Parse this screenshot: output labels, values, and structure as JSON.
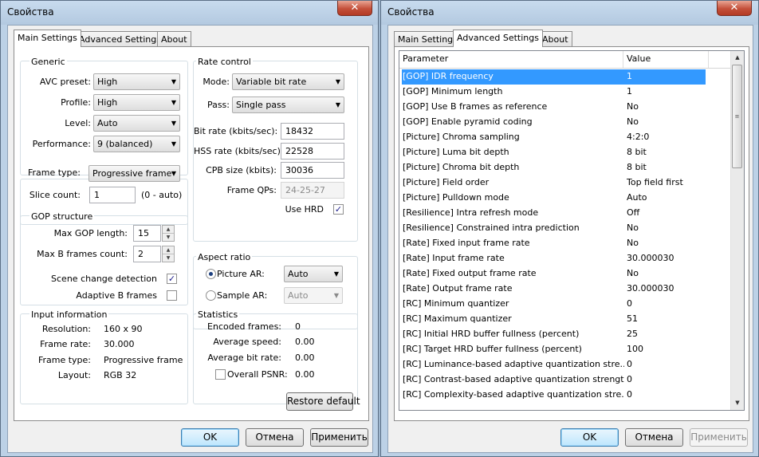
{
  "dialog_title": "Свойства",
  "tabs": [
    "Main Settings",
    "Advanced Settings",
    "About"
  ],
  "main": {
    "generic": {
      "title": "Generic",
      "avc_preset_label": "AVC preset:",
      "avc_preset": "High",
      "profile_label": "Profile:",
      "profile": "High",
      "level_label": "Level:",
      "level": "Auto",
      "performance_label": "Performance:",
      "performance": "9 (balanced)",
      "frame_type_label": "Frame type:",
      "frame_type": "Progressive frame",
      "slice_count_label": "Slice count:",
      "slice_count": "1",
      "slice_hint": "(0 - auto)"
    },
    "rate_control": {
      "title": "Rate control",
      "mode_label": "Mode:",
      "mode": "Variable bit rate",
      "pass_label": "Pass:",
      "pass": "Single pass",
      "bit_rate_label": "Bit rate (kbits/sec):",
      "bit_rate": "18432",
      "hss_rate_label": "HSS rate (kbits/sec):",
      "hss_rate": "22528",
      "cpb_size_label": "CPB size (kbits):",
      "cpb_size": "30036",
      "frame_qps_label": "Frame QPs:",
      "frame_qps": "24-25-27",
      "use_hrd_label": "Use HRD",
      "use_hrd": true
    },
    "gop": {
      "title": "GOP structure",
      "max_gop_label": "Max GOP length:",
      "max_gop": "15",
      "max_b_label": "Max B frames count:",
      "max_b": "2",
      "scene_change_label": "Scene change detection",
      "scene_change": true,
      "adaptive_b_label": "Adaptive B frames",
      "adaptive_b": false
    },
    "aspect": {
      "title": "Aspect ratio",
      "picture_ar_label": "Picture AR:",
      "picture_ar": "Auto",
      "picture_ar_selected": true,
      "sample_ar_label": "Sample AR:",
      "sample_ar": "Auto"
    },
    "input_info": {
      "title": "Input information",
      "resolution_label": "Resolution:",
      "resolution": "160 x 90",
      "frame_rate_label": "Frame rate:",
      "frame_rate": "30.000",
      "frame_type_label": "Frame type:",
      "frame_type": "Progressive frame",
      "layout_label": "Layout:",
      "layout": "RGB 32"
    },
    "statistics": {
      "title": "Statistics",
      "encoded_label": "Encoded frames:",
      "encoded": "0",
      "avg_speed_label": "Average speed:",
      "avg_speed": "0.00",
      "avg_bitrate_label": "Average bit rate:",
      "avg_bitrate": "0.00",
      "psnr_label": "Overall PSNR:",
      "psnr": "0.00"
    },
    "restore_default": "Restore default"
  },
  "advanced": {
    "col_param": "Parameter",
    "col_value": "Value",
    "rows": [
      {
        "p": "[GOP] IDR frequency",
        "v": "1"
      },
      {
        "p": "[GOP] Minimum length",
        "v": "1"
      },
      {
        "p": "[GOP] Use B frames as reference",
        "v": "No"
      },
      {
        "p": "[GOP] Enable pyramid coding",
        "v": "No"
      },
      {
        "p": "[Picture] Chroma sampling",
        "v": "4:2:0"
      },
      {
        "p": "[Picture] Luma bit depth",
        "v": "8 bit"
      },
      {
        "p": "[Picture] Chroma bit depth",
        "v": "8 bit"
      },
      {
        "p": "[Picture] Field order",
        "v": "Top field first"
      },
      {
        "p": "[Picture] Pulldown mode",
        "v": "Auto"
      },
      {
        "p": "[Resilience] Intra refresh mode",
        "v": "Off"
      },
      {
        "p": "[Resilience] Constrained intra prediction",
        "v": "No"
      },
      {
        "p": "[Rate] Fixed input frame rate",
        "v": "No"
      },
      {
        "p": "[Rate] Input frame rate",
        "v": "30.000030"
      },
      {
        "p": "[Rate] Fixed output frame rate",
        "v": "No"
      },
      {
        "p": "[Rate] Output frame rate",
        "v": "30.000030"
      },
      {
        "p": "[RC] Minimum quantizer",
        "v": "0"
      },
      {
        "p": "[RC] Maximum quantizer",
        "v": "51"
      },
      {
        "p": "[RC] Initial HRD buffer fullness (percent)",
        "v": "25"
      },
      {
        "p": "[RC] Target HRD buffer fullness (percent)",
        "v": "100"
      },
      {
        "p": "[RC] Luminance-based adaptive quantization stre...",
        "v": "0"
      },
      {
        "p": "[RC] Contrast-based adaptive quantization strength",
        "v": "0"
      },
      {
        "p": "[RC] Complexity-based adaptive quantization stre...",
        "v": "0"
      }
    ]
  },
  "buttons": {
    "ok": "OK",
    "cancel": "Отмена",
    "apply": "Применить"
  }
}
